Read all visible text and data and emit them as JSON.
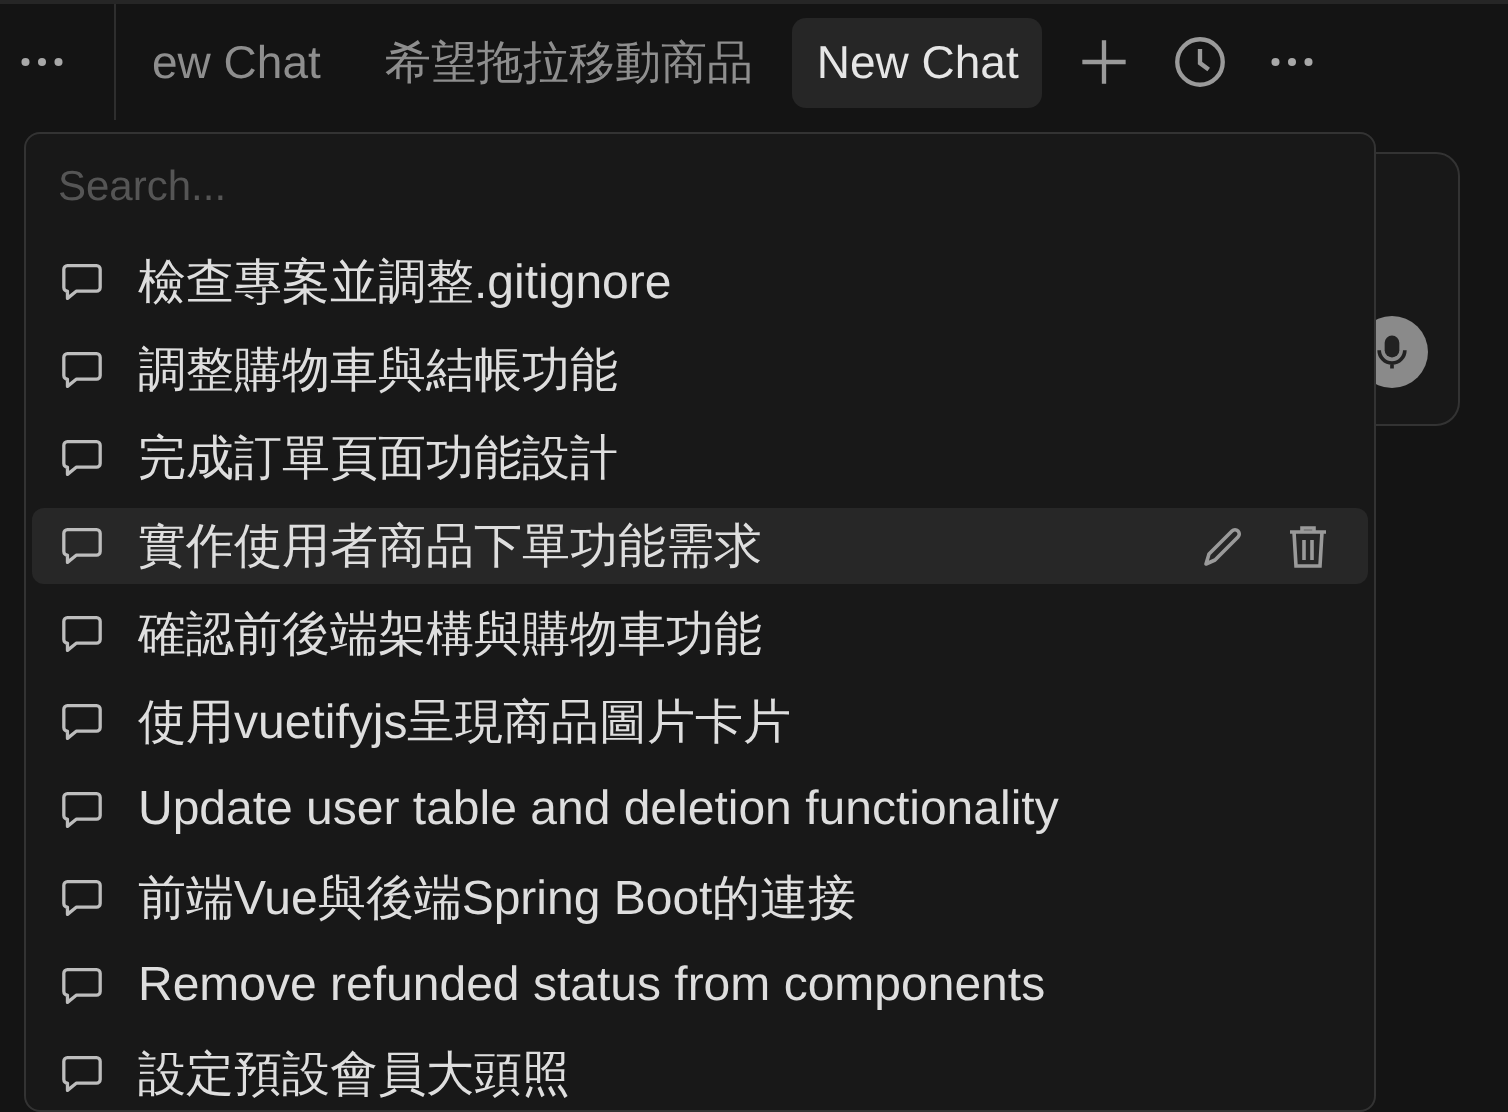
{
  "tabs": [
    {
      "label": "ew Chat",
      "selected": false
    },
    {
      "label": "希望拖拉移動商品",
      "selected": false
    },
    {
      "label": "New Chat",
      "selected": true
    }
  ],
  "history_menu": {
    "search": {
      "placeholder": "Search..."
    },
    "items": [
      {
        "title": "檢查專案並調整.gitignore",
        "hovered": false
      },
      {
        "title": "調整購物車與結帳功能",
        "hovered": false
      },
      {
        "title": "完成訂單頁面功能設計",
        "hovered": false
      },
      {
        "title": "實作使用者商品下單功能需求",
        "hovered": true
      },
      {
        "title": "確認前後端架構與購物車功能",
        "hovered": false
      },
      {
        "title": "使用vuetifyjs呈現商品圖片卡片",
        "hovered": false
      },
      {
        "title": "Update user table and deletion functionality",
        "hovered": false
      },
      {
        "title": "前端Vue與後端Spring Boot的連接",
        "hovered": false
      },
      {
        "title": "Remove refunded status from components",
        "hovered": false
      },
      {
        "title": "設定預設會員大頭照",
        "hovered": false
      }
    ]
  }
}
